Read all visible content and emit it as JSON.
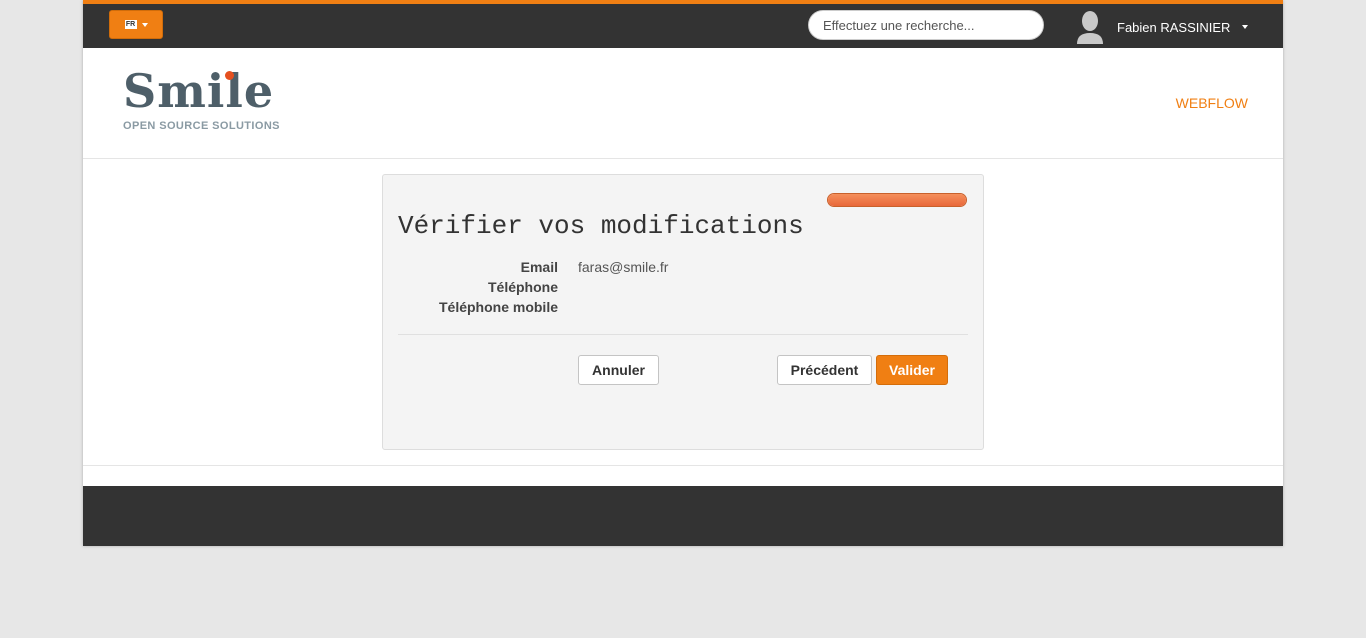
{
  "topbar": {
    "language_code": "FR",
    "search_placeholder": "Effectuez une recherche...",
    "user_name": "Fabien RASSINIER"
  },
  "header": {
    "logo_text": "Smile",
    "logo_subtitle": "OPEN SOURCE SOLUTIONS",
    "nav_link": "WEBFLOW"
  },
  "panel": {
    "progress_percent": 100,
    "title": "Vérifier vos modifications",
    "fields": [
      {
        "label": "Email",
        "value": "faras@smile.fr"
      },
      {
        "label": "Téléphone",
        "value": ""
      },
      {
        "label": "Téléphone mobile",
        "value": ""
      }
    ],
    "buttons": {
      "cancel": "Annuler",
      "previous": "Précédent",
      "submit": "Valider"
    }
  },
  "colors": {
    "accent": "#f07f13",
    "topbar": "#333333",
    "progress": "#e8683a",
    "logo": "#4e5f69"
  }
}
